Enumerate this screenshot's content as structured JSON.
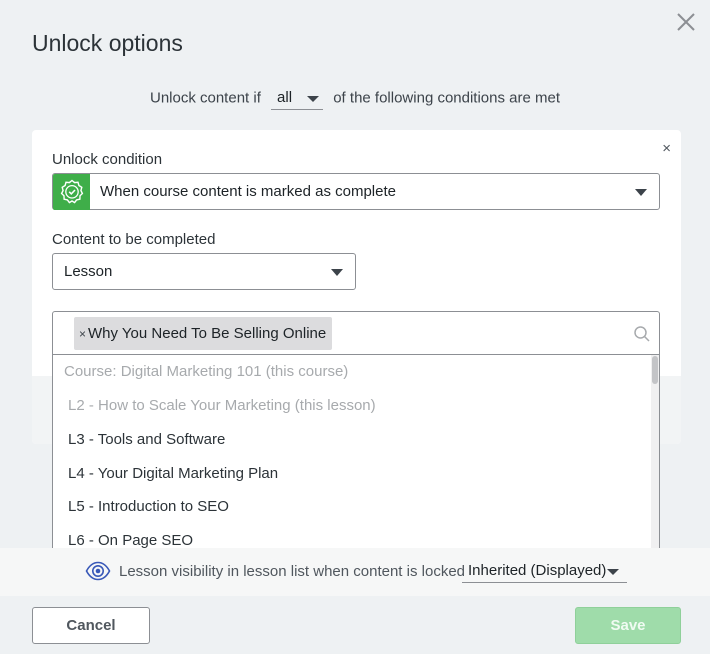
{
  "dialog": {
    "title": "Unlock options",
    "close_icon": "close-icon"
  },
  "rule": {
    "prefix": "Unlock content if",
    "mode_value": "all",
    "suffix": "of the following conditions are met"
  },
  "condition_card": {
    "close_symbol": "×",
    "unlock_condition_label": "Unlock condition",
    "unlock_condition_icon": "badge-check-icon",
    "unlock_condition_value": "When course content is marked as complete",
    "content_label": "Content to be completed",
    "content_value": "Lesson",
    "selected_chip": "Why You Need To Be Selling Online",
    "chip_remove_symbol": "×",
    "accent_color": "#3fae49"
  },
  "dropdown": {
    "options": [
      {
        "label": "Course: Digital Marketing 101 (this course)",
        "disabled": true
      },
      {
        "label": "L2 - How to Scale Your Marketing (this lesson)",
        "disabled": true
      },
      {
        "label": "L3 - Tools and Software",
        "disabled": false
      },
      {
        "label": "L4 - Your Digital Marketing Plan",
        "disabled": false
      },
      {
        "label": "L5 - Introduction to SEO",
        "disabled": false
      },
      {
        "label": "L6 - On Page SEO",
        "disabled": false
      }
    ]
  },
  "visibility": {
    "icon": "eye-icon",
    "label": "Lesson visibility in lesson list when content is locked",
    "value": "Inherited (Displayed)"
  },
  "footer": {
    "cancel_label": "Cancel",
    "save_label": "Save"
  }
}
